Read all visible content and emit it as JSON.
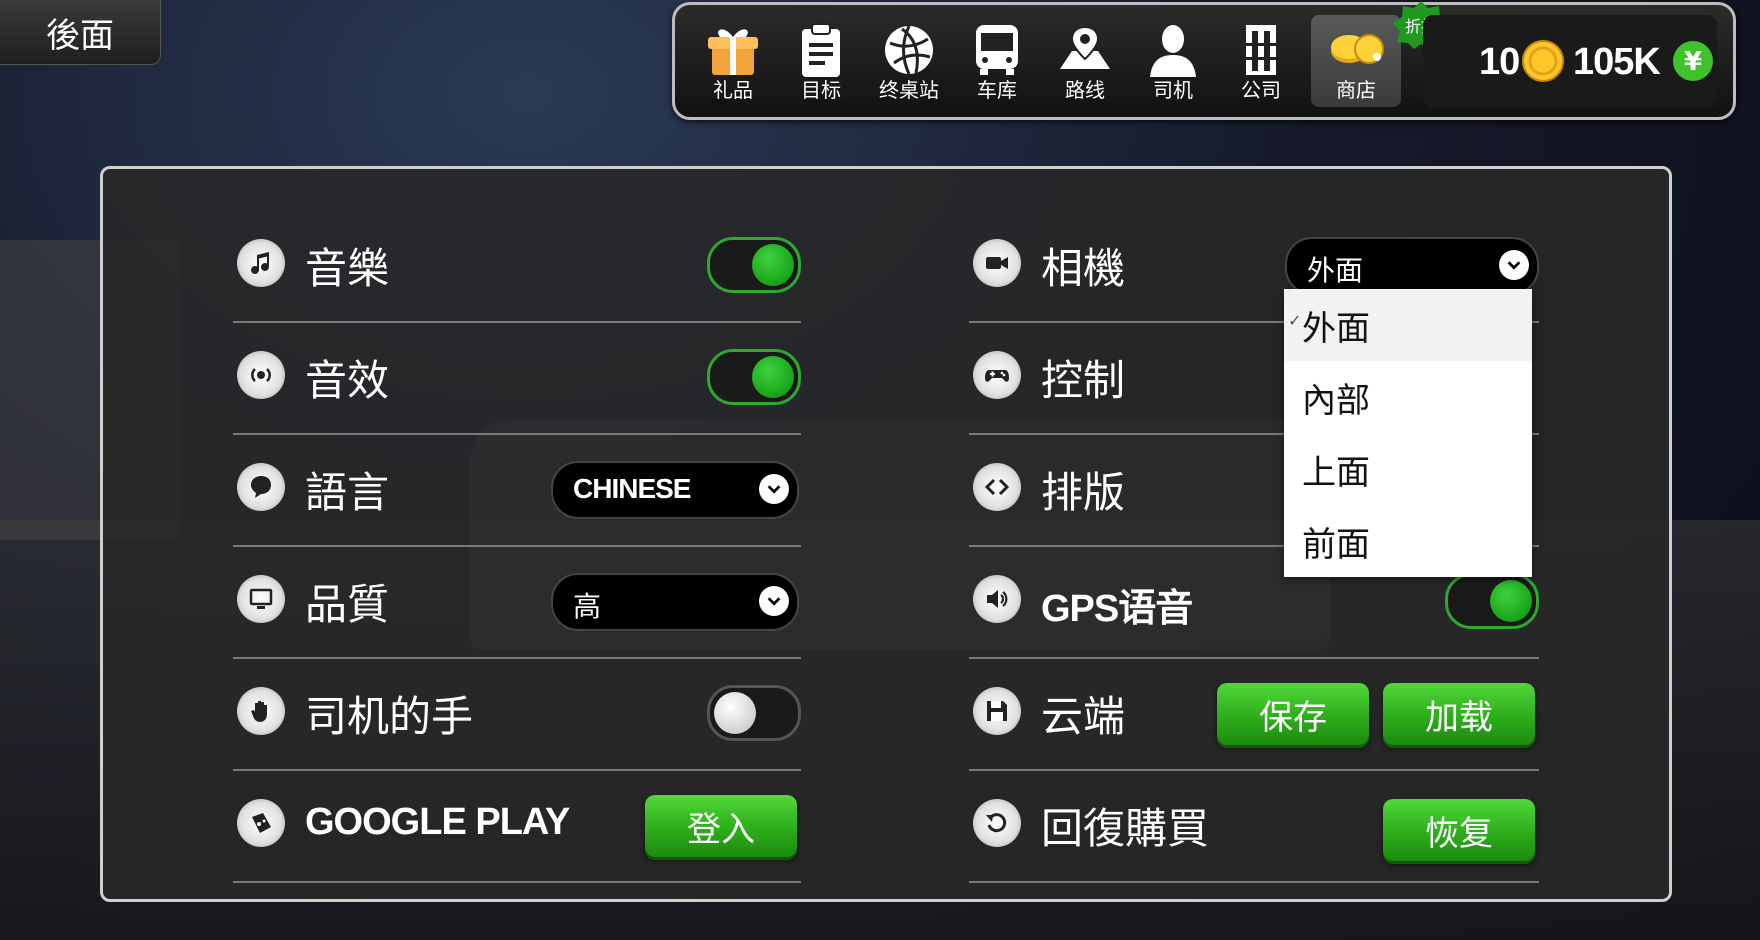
{
  "back_label": "後面",
  "nav": [
    {
      "id": "gift",
      "label": "礼品",
      "icon": "gift-icon"
    },
    {
      "id": "goals",
      "label": "目标",
      "icon": "clipboard-icon"
    },
    {
      "id": "terminal",
      "label": "终桌站",
      "icon": "globe-icon"
    },
    {
      "id": "garage",
      "label": "车库",
      "icon": "bus-icon"
    },
    {
      "id": "routes",
      "label": "路线",
      "icon": "map-pin-icon"
    },
    {
      "id": "drivers",
      "label": "司机",
      "icon": "person-icon"
    },
    {
      "id": "company",
      "label": "公司",
      "icon": "building-icon"
    },
    {
      "id": "shop",
      "label": "商店",
      "icon": "coins-icon"
    }
  ],
  "discount_badge": "折扣",
  "currency": {
    "coins": "10",
    "cash": "105K",
    "cash_symbol": "¥"
  },
  "settings": {
    "left": [
      {
        "label": "音樂",
        "control": "toggle",
        "state": "on",
        "icon": "music-icon"
      },
      {
        "label": "音效",
        "control": "toggle",
        "state": "on",
        "icon": "sound-effects-icon"
      },
      {
        "label": "語言",
        "control": "select",
        "value": "CHINESE",
        "icon": "speech-bubble-icon"
      },
      {
        "label": "品質",
        "control": "select",
        "value": "高",
        "icon": "monitor-icon"
      },
      {
        "label": "司机的手",
        "control": "toggle",
        "state": "off",
        "icon": "hand-icon"
      },
      {
        "label": "GOOGLE PLAY",
        "control": "button",
        "button": "登入",
        "icon": "gamepad-icon"
      }
    ],
    "right": [
      {
        "label": "相機",
        "control": "select",
        "value": "外面",
        "icon": "camera-icon"
      },
      {
        "label": "控制",
        "control": "none",
        "icon": "controller-icon"
      },
      {
        "label": "排版",
        "control": "none",
        "icon": "code-brackets-icon"
      },
      {
        "label": "GPS语音",
        "control": "toggle",
        "state": "on",
        "icon": "speaker-icon"
      },
      {
        "label": "云端",
        "control": "buttons",
        "buttons": [
          "保存",
          "加载"
        ],
        "icon": "floppy-icon"
      },
      {
        "label": "回復購買",
        "control": "button",
        "button": "恢复",
        "icon": "restore-icon"
      }
    ]
  },
  "camera_dropdown": {
    "options": [
      "外面",
      "內部",
      "上面",
      "前面"
    ],
    "selected": "外面",
    "check": "✓"
  }
}
